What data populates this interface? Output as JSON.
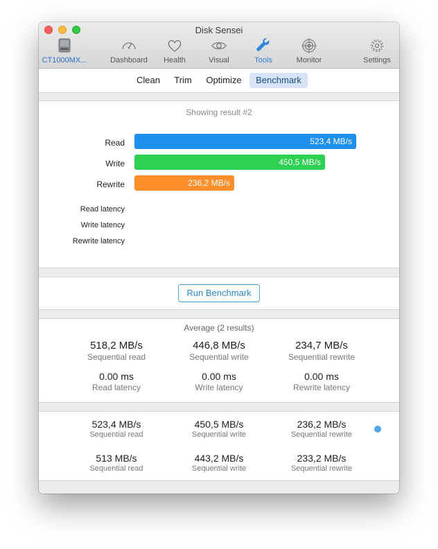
{
  "window": {
    "title": "Disk Sensei"
  },
  "toolbar": {
    "disk_label": "CT1000MX...",
    "items": [
      {
        "label": "Dashboard",
        "icon": "speedometer-icon"
      },
      {
        "label": "Health",
        "icon": "heart-icon"
      },
      {
        "label": "Visual",
        "icon": "eye-icon"
      },
      {
        "label": "Tools",
        "icon": "wrench-icon"
      },
      {
        "label": "Monitor",
        "icon": "target-icon"
      },
      {
        "label": "Settings",
        "icon": "gear-icon"
      }
    ],
    "active": "Tools"
  },
  "segments": {
    "items": [
      "Clean",
      "Trim",
      "Optimize",
      "Benchmark"
    ],
    "active": "Benchmark"
  },
  "benchmark": {
    "showing": "Showing result #2",
    "scale_max": 523.4,
    "bars": [
      {
        "label": "Read",
        "value": 523.4,
        "text": "523,4 MB/s",
        "color": "#1e90f0"
      },
      {
        "label": "Write",
        "value": 450.5,
        "text": "450,5 MB/s",
        "color": "#2dd152"
      },
      {
        "label": "Rewrite",
        "value": 236.2,
        "text": "236,2 MB/s",
        "color": "#fd8e2a"
      }
    ],
    "latency_labels": [
      "Read latency",
      "Write latency",
      "Rewrite latency"
    ]
  },
  "run_button": "Run Benchmark",
  "average": {
    "title": "Average (2 results)",
    "stats": [
      {
        "value": "518,2 MB/s",
        "caption": "Sequential read"
      },
      {
        "value": "446,8 MB/s",
        "caption": "Sequential write"
      },
      {
        "value": "234,7 MB/s",
        "caption": "Sequential rewrite"
      },
      {
        "value": "0.00 ms",
        "caption": "Read latency"
      },
      {
        "value": "0.00 ms",
        "caption": "Write latency"
      },
      {
        "value": "0.00 ms",
        "caption": "Rewrite latency"
      }
    ]
  },
  "results": [
    {
      "selected": true,
      "stats": [
        {
          "value": "523,4 MB/s",
          "caption": "Sequential read"
        },
        {
          "value": "450,5 MB/s",
          "caption": "Sequential write"
        },
        {
          "value": "236,2 MB/s",
          "caption": "Sequential rewrite"
        }
      ]
    },
    {
      "selected": false,
      "stats": [
        {
          "value": "513 MB/s",
          "caption": "Sequential read"
        },
        {
          "value": "443,2 MB/s",
          "caption": "Sequential write"
        },
        {
          "value": "233,2 MB/s",
          "caption": "Sequential rewrite"
        }
      ]
    }
  ]
}
